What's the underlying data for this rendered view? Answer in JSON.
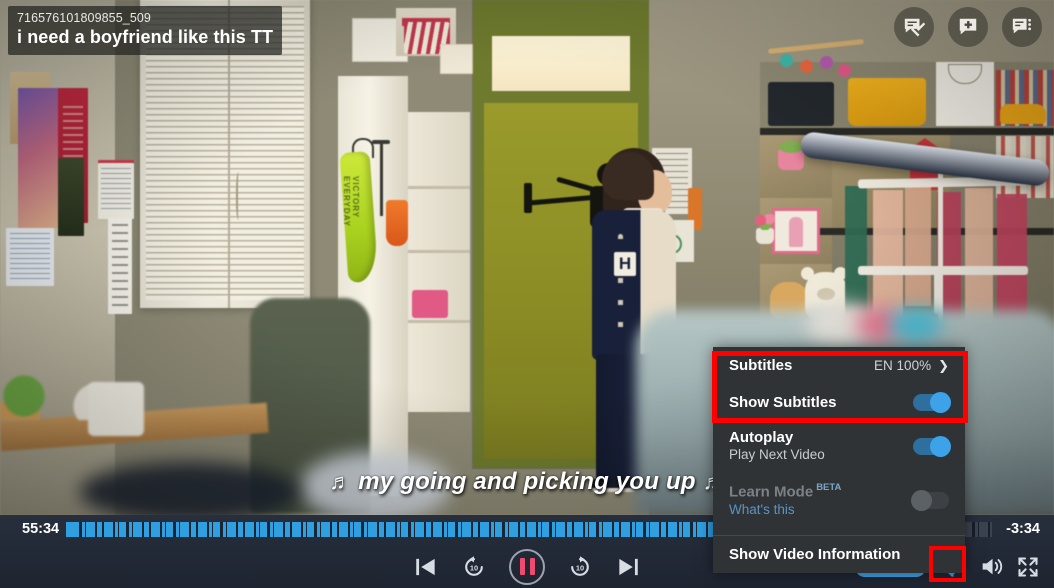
{
  "video_overlay": {
    "clip_id": "716576101809855_509",
    "clip_title": "i need a boyfriend like this TT",
    "subtitle_text": "my going and picking you up",
    "note_glyph_left": "♬",
    "note_glyph_right": "♬"
  },
  "top_icons": [
    {
      "name": "hide-captions-icon",
      "label": "Hide Captions"
    },
    {
      "name": "add-caption-icon",
      "label": "Add Caption"
    },
    {
      "name": "caption-list-icon",
      "label": "Caption List"
    }
  ],
  "settings_menu": {
    "subtitles": {
      "label": "Subtitles",
      "value": "EN 100%",
      "chevron": "❯"
    },
    "show_subtitles": {
      "label": "Show Subtitles",
      "state": "on"
    },
    "autoplay": {
      "label": "Autoplay",
      "sublabel": "Play Next Video",
      "state": "on"
    },
    "learn_mode": {
      "label": "Learn Mode",
      "badge": "BETA",
      "sublabel": "What's this",
      "state": "off",
      "disabled": true
    },
    "video_info": {
      "label": "Show Video Information"
    }
  },
  "player_controls": {
    "time_elapsed": "55:34",
    "time_remaining": "-3:34",
    "progress_percent": 87.5,
    "previous_label": "Previous",
    "rewind_label": "10",
    "play_state": "paused",
    "forward_label": "10",
    "next_label": "Next",
    "language_badge": "EN",
    "language_percent": "100%",
    "settings_label": "Settings",
    "volume_label": "Volume",
    "fullscreen_label": "Fullscreen"
  },
  "colors": {
    "accent_blue": "#3da2e8",
    "progress_blue": "#2f9fe0",
    "highlight_red": "#ff0000",
    "pause_pink": "#ef4b6e",
    "menu_bg": "#303336",
    "bar_bg": "#242b38"
  }
}
